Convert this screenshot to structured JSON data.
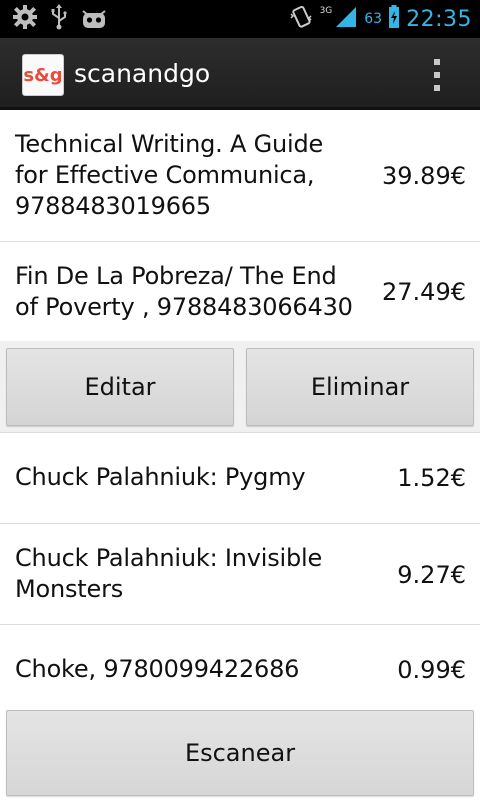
{
  "status_bar": {
    "time": "22:35",
    "battery_percent": "63",
    "network": "3G",
    "icons": [
      "gear-icon",
      "usb-icon",
      "android-icon",
      "vibrate-icon",
      "signal-icon",
      "battery-icon"
    ]
  },
  "action_bar": {
    "app_icon_text": "s&g",
    "title": "scanandgo",
    "overflow_icon": "overflow-menu-icon"
  },
  "items": [
    {
      "title_line1": "Technical Writing. A Guide",
      "title_line2": "for Effective Communica,",
      "title_line3": "9788483019665",
      "price": "39.89€"
    },
    {
      "title_line1": "Fin De La Pobreza/ The End",
      "title_line2": "of Poverty , 9788483066430",
      "price": "27.49€"
    },
    {
      "title_line1": "Chuck Palahniuk: Pygmy",
      "price": "1.52€"
    },
    {
      "title_line1": "Chuck Palahniuk: Invisible",
      "title_line2": "Monsters",
      "price": "9.27€"
    },
    {
      "title_line1": "Choke, 9780099422686",
      "price": "0.99€"
    }
  ],
  "item_actions": {
    "edit_label": "Editar",
    "delete_label": "Eliminar"
  },
  "scan_button": {
    "label": "Escanear"
  },
  "colors": {
    "accent": "#33b5e5",
    "app_icon_text": "#e74c3c",
    "action_bar": "#2d2d2d"
  }
}
